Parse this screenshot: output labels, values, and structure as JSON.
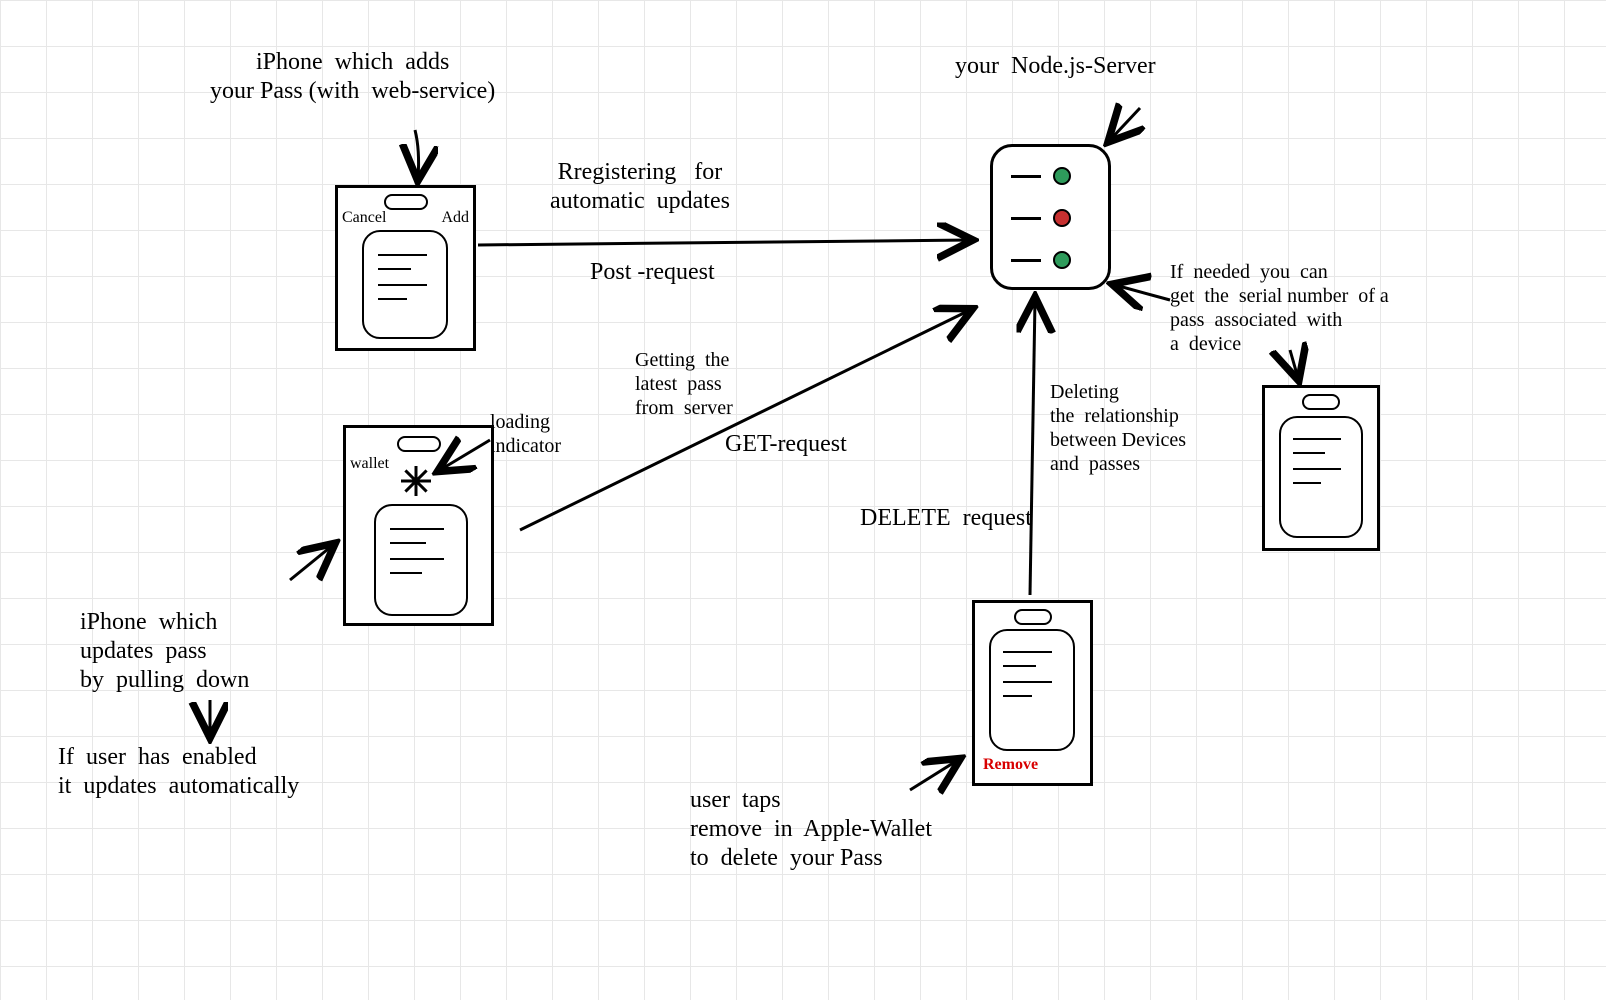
{
  "title_iphone_add": "iPhone  which  adds\nyour Pass (with  web-service)",
  "title_server": "your  Node.js-Server",
  "register_line1": "Rregistering   for\nautomatic  updates",
  "register_line2": "Post -request",
  "get_line1": "Getting  the\nlatest  pass\nfrom  server",
  "get_line2": "GET-request",
  "delete_line1": "Deleting\nthe  relationship\nbetween Devices\nand  passes",
  "delete_line2": "DELETE  request",
  "serial_note": "If  needed  you  can\nget  the  serial number  of a\npass  associated  with\na  device",
  "loading_label": "loading\nindicator",
  "pulldown_label": "iPhone  which\nupdates  pass\nby  pulling  down",
  "auto_label": "If  user  has  enabled\nit  updates  automatically",
  "remove_label": "Remove",
  "remove_note": "user  taps\nremove  in  Apple-Wallet\nto  delete  your Pass",
  "phone1_cancel": "Cancel",
  "phone1_add": "Add",
  "phone2_wallet": "wallet"
}
